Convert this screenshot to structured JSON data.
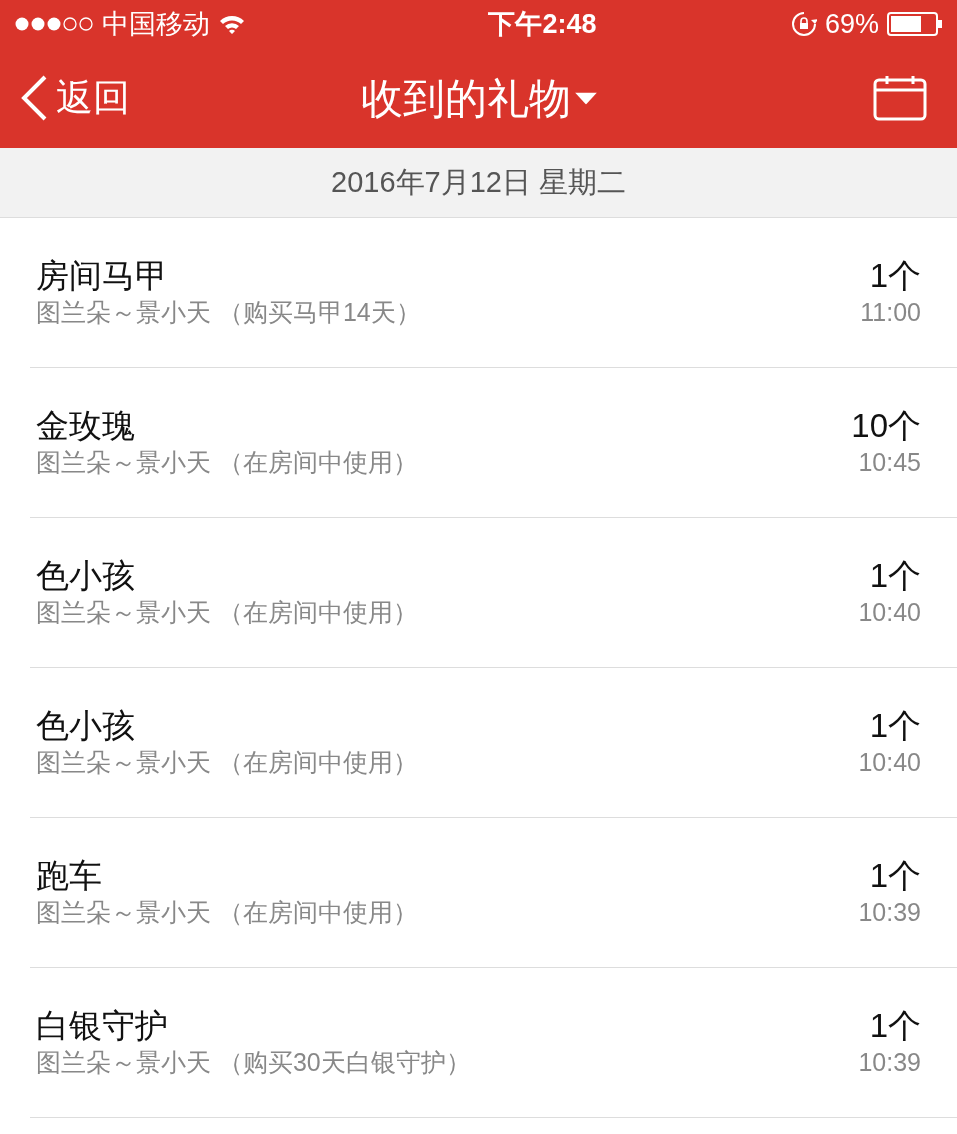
{
  "status_bar": {
    "carrier": "中国移动",
    "time": "下午2:48",
    "battery": "69%"
  },
  "nav": {
    "back": "返回",
    "title": "收到的礼物"
  },
  "date_header": "2016年7月12日 星期二",
  "gifts": [
    {
      "name": "房间马甲",
      "detail": "图兰朵～景小天 （购买马甲14天）",
      "count": "1个",
      "time": "11:00"
    },
    {
      "name": "金玫瑰",
      "detail": "图兰朵～景小天 （在房间中使用）",
      "count": "10个",
      "time": "10:45"
    },
    {
      "name": "色小孩",
      "detail": "图兰朵～景小天 （在房间中使用）",
      "count": "1个",
      "time": "10:40"
    },
    {
      "name": "色小孩",
      "detail": "图兰朵～景小天 （在房间中使用）",
      "count": "1个",
      "time": "10:40"
    },
    {
      "name": "跑车",
      "detail": "图兰朵～景小天 （在房间中使用）",
      "count": "1个",
      "time": "10:39"
    },
    {
      "name": "白银守护",
      "detail": "图兰朵～景小天 （购买30天白银守护）",
      "count": "1个",
      "time": "10:39"
    }
  ]
}
